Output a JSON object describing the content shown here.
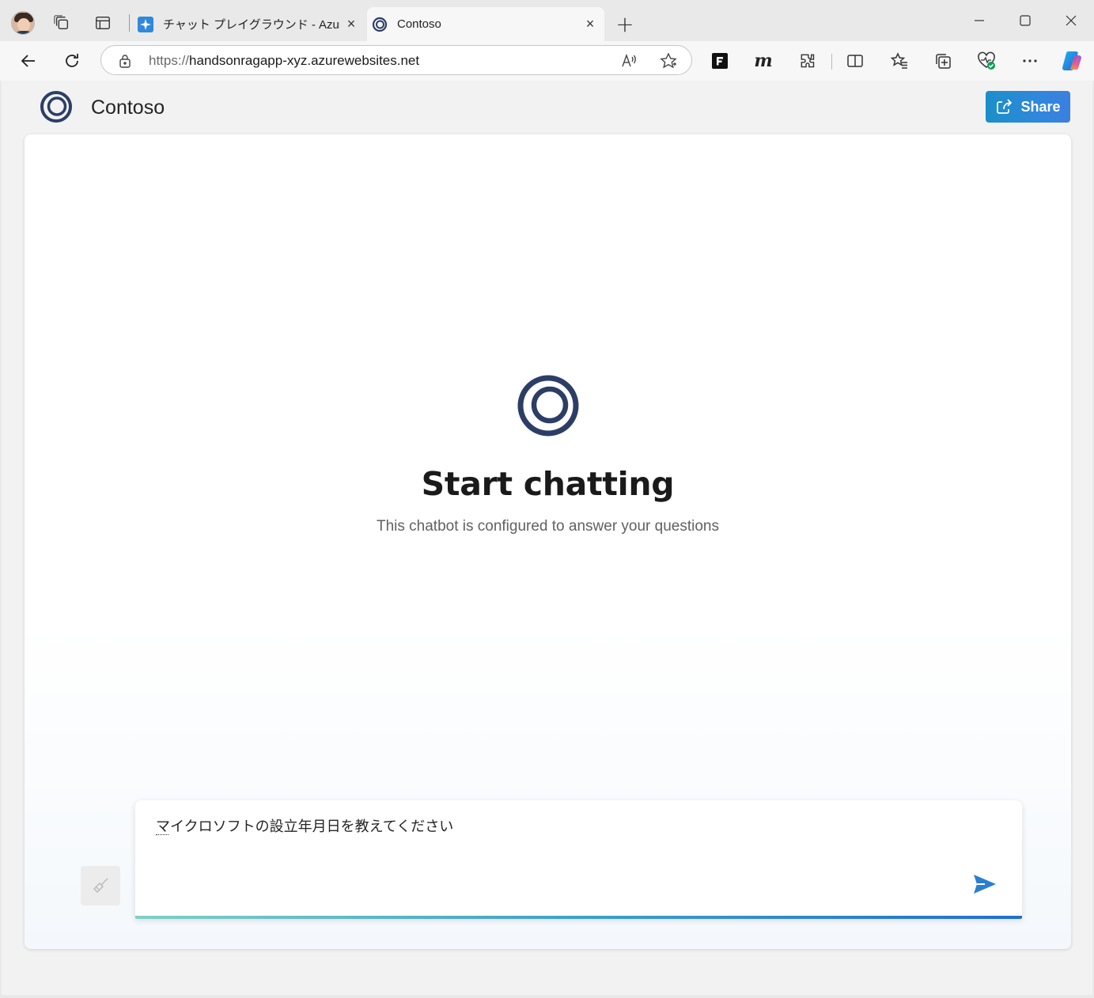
{
  "browser": {
    "tabs": [
      {
        "title": "チャット プレイグラウンド - Azure Open",
        "close": "×",
        "favicon": "azure-ai-icon",
        "active": false
      },
      {
        "title": "Contoso",
        "close": "×",
        "favicon": "contoso-icon",
        "active": true
      }
    ],
    "new_tab": "+",
    "address": {
      "scheme": "https://",
      "host": "handsonragapp-xyz.azurewebsites.net"
    },
    "toolbar_icons": [
      "read-aloud-icon",
      "favorite-star-icon",
      "frame-extension-icon",
      "m-extension-icon",
      "extensions-icon",
      "split-screen-icon",
      "favorites-icon",
      "collections-icon",
      "browser-essentials-icon",
      "more-icon",
      "copilot-icon"
    ],
    "ext_m_label": "m"
  },
  "app": {
    "brand_name": "Contoso",
    "share_label": "Share",
    "hero_title": "Start chatting",
    "hero_subtitle": "This chatbot is configured to answer your questions",
    "input_value": "マイクロソフトの設立年月日を教えてください",
    "accent": "#2f88dc",
    "logo_color": "#2c3e66"
  }
}
